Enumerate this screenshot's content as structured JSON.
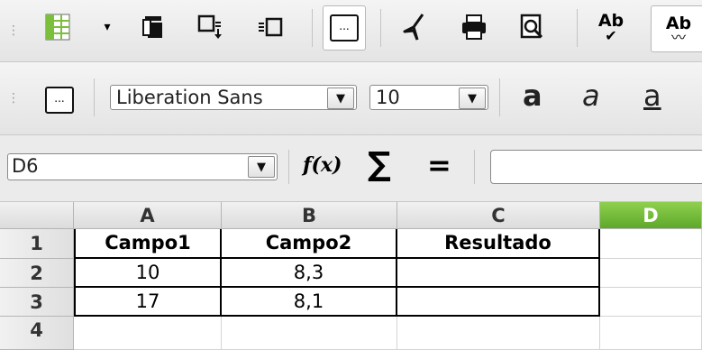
{
  "toolbar_standard": {
    "icons": [
      "spreadsheet-icon",
      "dropdown-arrow-icon",
      "copy-icon",
      "insert-rows-icon",
      "insert-columns-icon",
      "ellipsis-icon",
      "clone-format-icon",
      "print-icon",
      "print-preview-icon",
      "spellcheck-icon",
      "autospellcheck-icon"
    ],
    "ellipsis": "...",
    "ab1": "Ab",
    "ab2": "Ab"
  },
  "toolbar_format": {
    "ellipsis": "...",
    "font_name": "Liberation Sans",
    "font_size": "10",
    "bold_glyph": "a",
    "italic_glyph": "a",
    "underline_glyph": "a"
  },
  "formula_bar": {
    "name_box": "D6",
    "fx_label": "f(x)",
    "sum_glyph": "∑",
    "equals_glyph": "=",
    "input_value": ""
  },
  "grid": {
    "columns": [
      "A",
      "B",
      "C",
      "D"
    ],
    "rows": [
      "1",
      "2",
      "3",
      "4"
    ],
    "cells": [
      [
        "Campo1",
        "Campo2",
        "Resultado",
        ""
      ],
      [
        "10",
        "8,3",
        "",
        ""
      ],
      [
        "17",
        "8,1",
        "",
        ""
      ],
      [
        "",
        "",
        "",
        ""
      ]
    ]
  }
}
